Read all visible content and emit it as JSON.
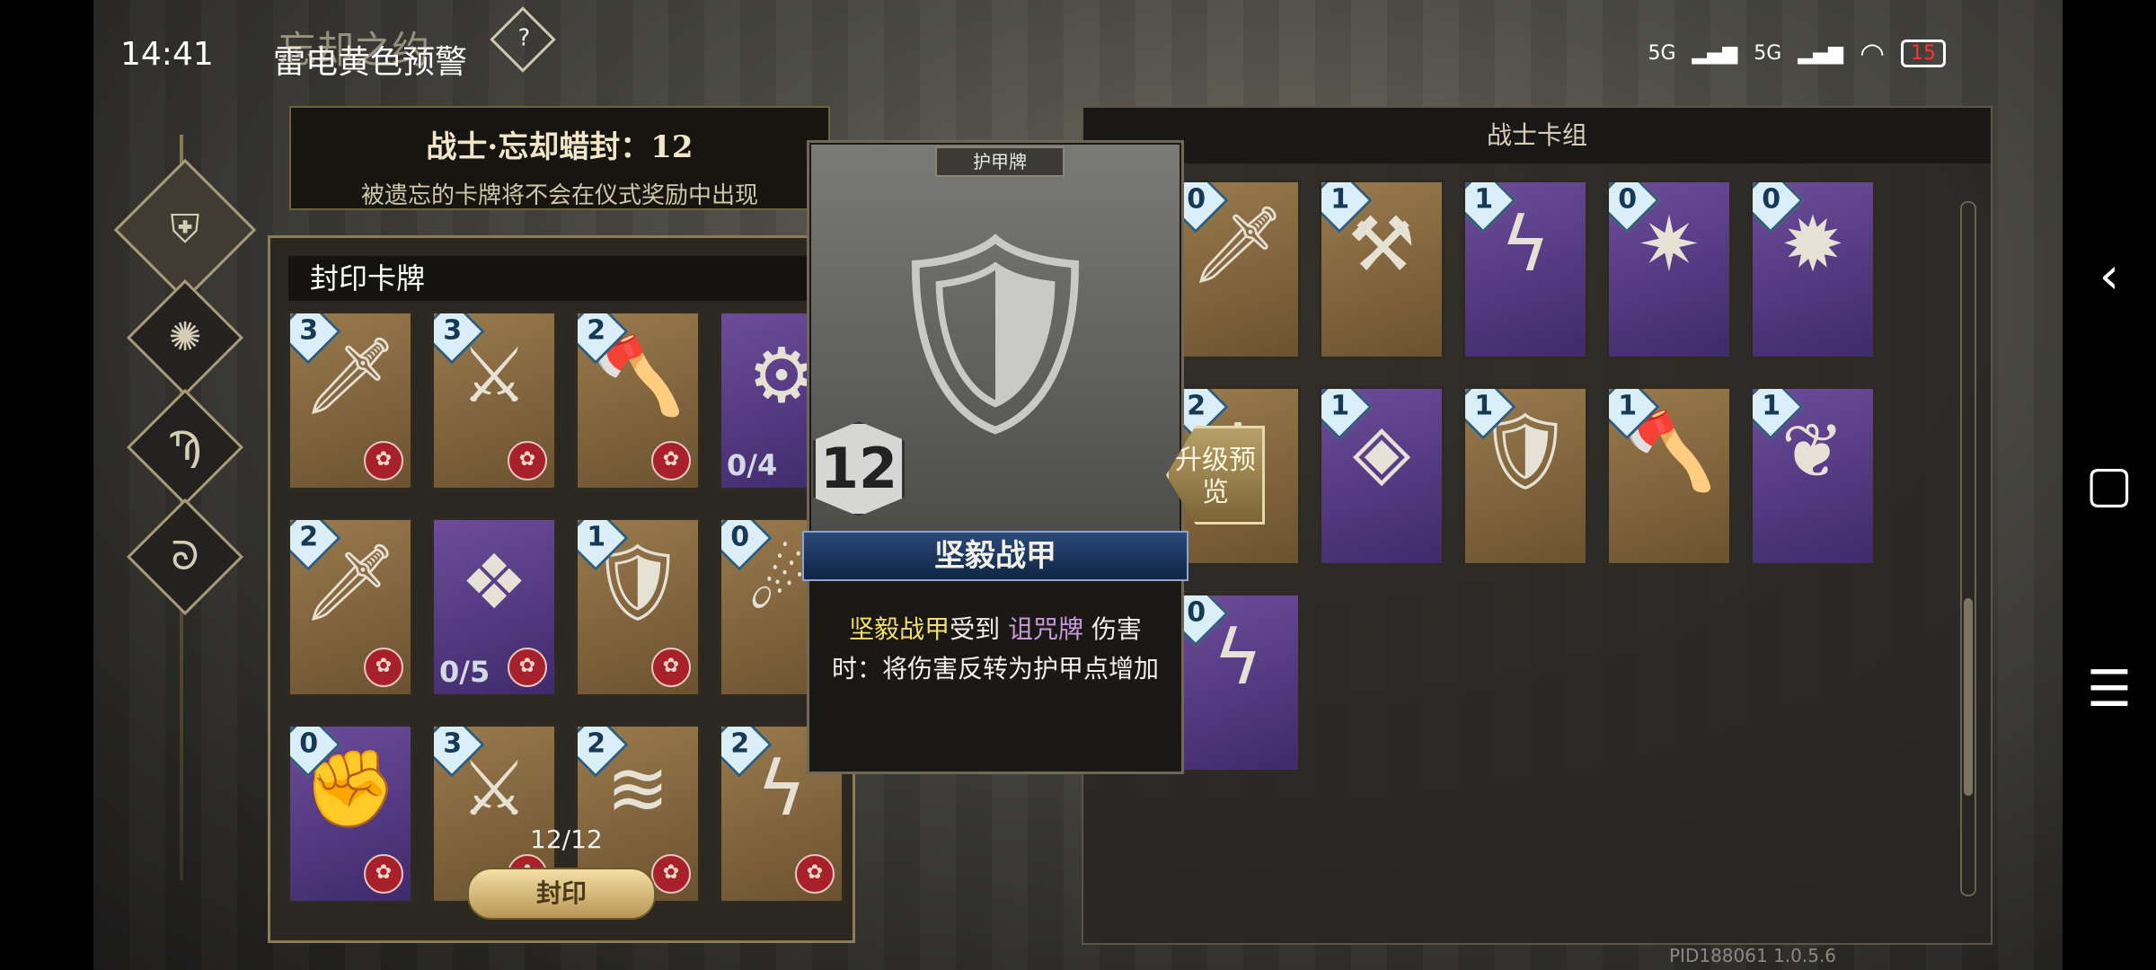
{
  "status_bar": {
    "time": "14:41",
    "weather": "雷电黄色预警",
    "signal1": "5G",
    "signal2": "5G",
    "battery": "15"
  },
  "faded_title": "忘却之约",
  "help_icon": "?",
  "side_nav": [
    {
      "name": "shield-crest-icon",
      "glyph": "⛨",
      "active": true
    },
    {
      "name": "flame-crest-icon",
      "glyph": "✺",
      "active": false
    },
    {
      "name": "rune-crest-icon",
      "glyph": "Ϡ",
      "active": false
    },
    {
      "name": "swirl-crest-icon",
      "glyph": "ᘐ",
      "active": false
    }
  ],
  "banner": {
    "title": "战士·忘却蜡封：12",
    "subtitle": "被遗忘的卡牌将不会在仪式奖励中出现"
  },
  "sealed_panel": {
    "header": "封印卡牌",
    "cards": [
      {
        "cost": "3",
        "color": "brown",
        "art": "🗡",
        "seal": true
      },
      {
        "cost": "3",
        "color": "brown",
        "art": "⚔",
        "seal": true
      },
      {
        "cost": "2",
        "color": "brown",
        "art": "🪓",
        "seal": true
      },
      {
        "cost": "",
        "color": "purple",
        "art": "⚙",
        "seal": false,
        "upgrade": "0/4"
      },
      {
        "cost": "2",
        "color": "brown",
        "art": "🗡",
        "seal": true
      },
      {
        "cost": "",
        "color": "purple",
        "art": "❖",
        "seal": true,
        "upgrade": "0/5"
      },
      {
        "cost": "1",
        "color": "brown",
        "art": "🛡",
        "seal": true
      },
      {
        "cost": "0",
        "color": "brown",
        "art": "☄",
        "seal": false
      },
      {
        "cost": "0",
        "color": "purple",
        "art": "✊",
        "seal": true
      },
      {
        "cost": "3",
        "color": "brown",
        "art": "⚔",
        "seal": true
      },
      {
        "cost": "2",
        "color": "brown",
        "art": "≋",
        "seal": true
      },
      {
        "cost": "2",
        "color": "brown",
        "art": "ϟ",
        "seal": true
      }
    ],
    "count": "12/12",
    "seal_button": "封印"
  },
  "detail_card": {
    "type_label": "护甲牌",
    "cost": "12",
    "art": "🛡",
    "name": "坚毅战甲",
    "desc": {
      "part1": "坚毅战甲",
      "part2": "受到 ",
      "part3": "诅咒牌",
      "part4": " 伤害时：将伤害反转为护甲点增加"
    },
    "upgrade_preview": "升级预览"
  },
  "deck_panel": {
    "header": "战士卡组",
    "cards": [
      {
        "cost": "0",
        "color": "brown",
        "art": "🗡"
      },
      {
        "cost": "1",
        "color": "brown",
        "art": "⚒"
      },
      {
        "cost": "1",
        "color": "purple",
        "art": "ϟ"
      },
      {
        "cost": "0",
        "color": "purple",
        "art": "✷"
      },
      {
        "cost": "0",
        "color": "purple",
        "art": "✹"
      },
      {
        "cost": "2",
        "color": "brown",
        "art": "⚙"
      },
      {
        "cost": "1",
        "color": "purple",
        "art": "◈"
      },
      {
        "cost": "1",
        "color": "brown",
        "art": "🛡"
      },
      {
        "cost": "1",
        "color": "brown",
        "art": "🪓"
      },
      {
        "cost": "1",
        "color": "purple",
        "art": "❦"
      },
      {
        "cost": "0",
        "color": "purple",
        "art": "ϟ"
      }
    ]
  },
  "pid": "PID188061  1.0.5.6",
  "android_nav": {
    "back": "‹",
    "home": "▢",
    "menu": "☰"
  }
}
